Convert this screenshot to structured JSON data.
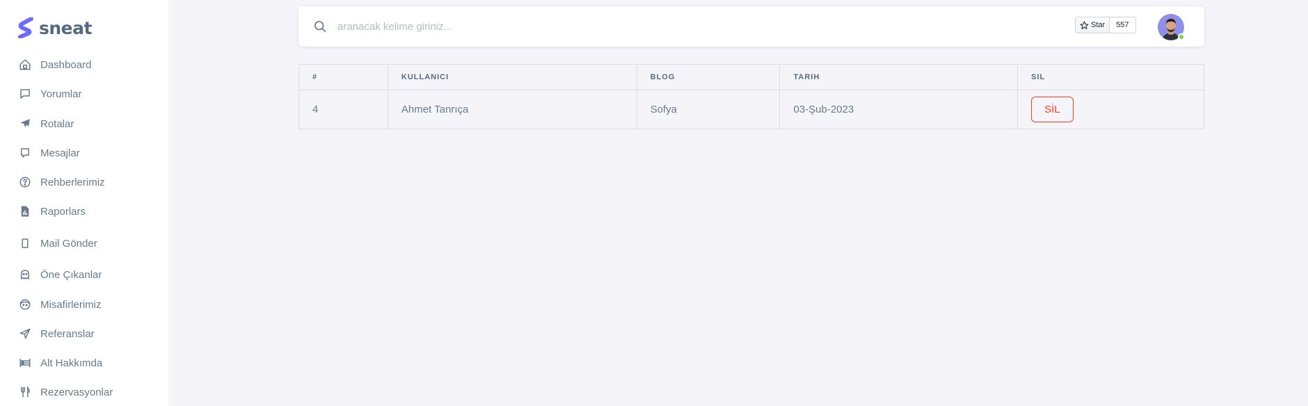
{
  "brand": {
    "name": "sneat",
    "accent": "#696cff"
  },
  "sidebar": {
    "items": [
      {
        "label": "Dashboard",
        "icon": "home-icon"
      },
      {
        "label": "Yorumlar",
        "icon": "comment-icon"
      },
      {
        "label": "Rotalar",
        "icon": "plane-icon"
      },
      {
        "label": "Mesajlar",
        "icon": "message-icon"
      },
      {
        "label": "Rehberlerimiz",
        "icon": "help-circle-icon"
      },
      {
        "label": "Raporlars",
        "icon": "report-file-icon"
      },
      {
        "label": "Mail Gönder",
        "icon": "mail-icon"
      },
      {
        "label": "Öne Çıkanlar",
        "icon": "ghost-icon"
      },
      {
        "label": "Misafirlerimiz",
        "icon": "face-icon"
      },
      {
        "label": "Referanslar",
        "icon": "send-icon"
      },
      {
        "label": "Alt Hakkımda",
        "icon": "list-icon"
      },
      {
        "label": "Rezervasyonlar",
        "icon": "restaurant-icon"
      }
    ]
  },
  "search": {
    "placeholder": "aranacak kelime giriniz...",
    "value": ""
  },
  "github": {
    "star_label": "Star",
    "star_count": "557"
  },
  "table": {
    "columns": [
      "#",
      "KULLANICI",
      "BLOG",
      "TARIH",
      "SIL"
    ],
    "rows": [
      {
        "id": "4",
        "user": "Ahmet Tanrıça",
        "blog": "Sofya",
        "date": "03-Şub-2023",
        "action": "SİL"
      }
    ]
  },
  "colors": {
    "danger": "#ff3e1d",
    "online": "#71dd37"
  }
}
